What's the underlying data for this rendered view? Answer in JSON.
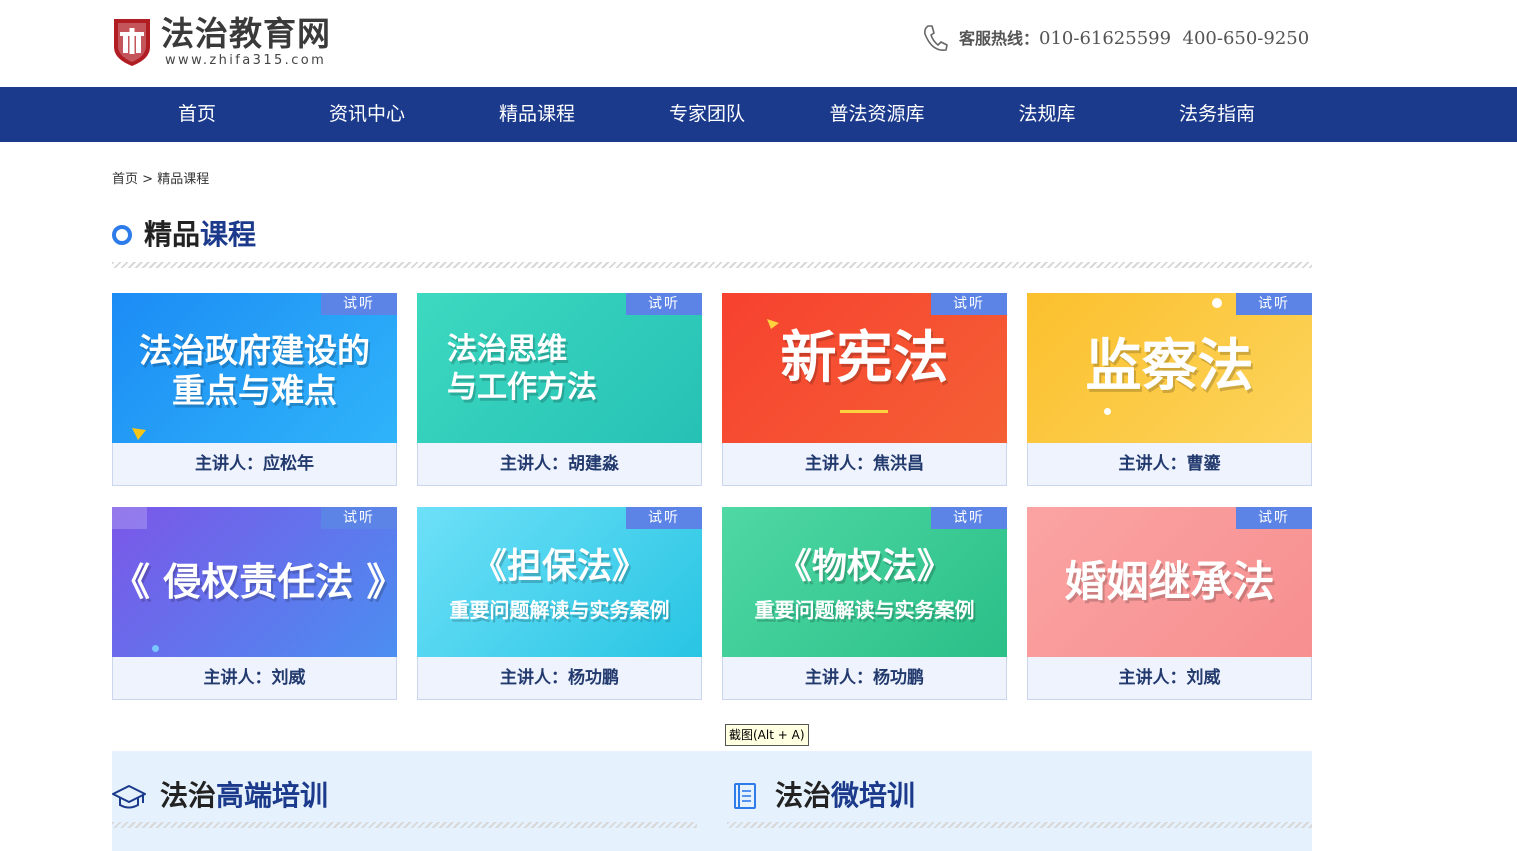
{
  "header": {
    "site_title": "法治教育网",
    "site_url": "www.zhifa315.com",
    "hotline_label": "客服热线：",
    "hotline_numbers": "010-61625599  400-650-9250"
  },
  "nav": [
    "首页",
    "资讯中心",
    "精品课程",
    "专家团队",
    "普法资源库",
    "法规库",
    "法务指南"
  ],
  "breadcrumb": {
    "home": "首页",
    "sep": ">",
    "current": "精品课程"
  },
  "section": {
    "title_a": "精品",
    "title_b": "课程"
  },
  "courses": [
    {
      "tag": "试听",
      "line1": "法治政府建设的",
      "line2": "重点与难点",
      "speaker": "主讲人：应松年"
    },
    {
      "tag": "试听",
      "line1": "法治思维",
      "line2": "与工作方法",
      "speaker": "主讲人：胡建淼"
    },
    {
      "tag": "试听",
      "line1": "新宪法",
      "line2": "",
      "speaker": "主讲人：焦洪昌"
    },
    {
      "tag": "试听",
      "line1": "监察法",
      "line2": "",
      "speaker": "主讲人：曹鎏"
    },
    {
      "tag": "试听",
      "line1": "《 侵权责任法 》",
      "line2": "",
      "speaker": "主讲人：刘威"
    },
    {
      "tag": "试听",
      "line1": "《担保法》",
      "line2": "重要问题解读与实务案例",
      "speaker": "主讲人：杨功鹏"
    },
    {
      "tag": "试听",
      "line1": "《物权法》",
      "line2": "重要问题解读与实务案例",
      "speaker": "主讲人：杨功鹏"
    },
    {
      "tag": "试听",
      "line1": "婚姻继承法",
      "line2": "",
      "speaker": "主讲人：刘威"
    }
  ],
  "tooltip": "截图(Alt + A)",
  "bottom": {
    "left": {
      "title_a": "法治",
      "title_b": "高端培训"
    },
    "right": {
      "title_a": "法治",
      "title_b": "微培训"
    }
  },
  "colors": {
    "nav_bg": "#1b3a8c",
    "accent_blue": "#2e7bea",
    "tag_bg": "#5b84e6",
    "panel_bg": "#e5f1fc"
  }
}
